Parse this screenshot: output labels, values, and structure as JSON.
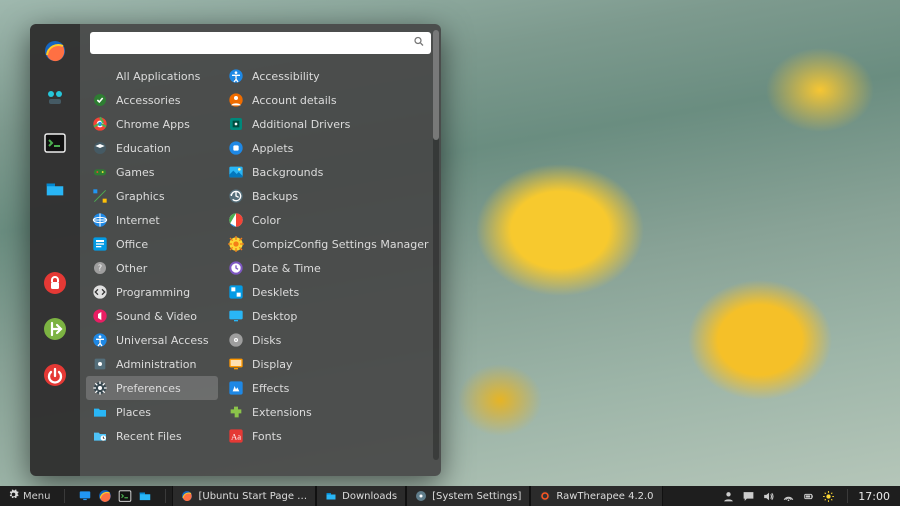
{
  "colors": {
    "panel_bg": "#1e1e1e",
    "menu_bg": "rgba(70,70,70,0.92)",
    "accent_orange": "#e64a19",
    "accent_blue": "#1e88e5",
    "accent_green": "#7cb342",
    "accent_red": "#e53935",
    "accent_yellow": "#fdd835"
  },
  "panel": {
    "menu_label": "Menu",
    "launchers": [
      {
        "name": "show-desktop-icon",
        "glyph": "desktop"
      },
      {
        "name": "firefox-icon",
        "glyph": "firefox"
      },
      {
        "name": "terminal-icon",
        "glyph": "terminal"
      },
      {
        "name": "files-icon",
        "glyph": "files"
      }
    ],
    "tasks": [
      {
        "icon": "firefox",
        "label": "[Ubuntu Start Page …"
      },
      {
        "icon": "files",
        "label": "Downloads"
      },
      {
        "icon": "settings",
        "label": "[System Settings]"
      },
      {
        "icon": "rawtherapee",
        "label": "RawTherapee 4.2.0"
      }
    ],
    "tray": [
      {
        "name": "user-icon",
        "glyph": "user"
      },
      {
        "name": "chat-icon",
        "glyph": "chat"
      },
      {
        "name": "volume-icon",
        "glyph": "volume"
      },
      {
        "name": "network-icon",
        "glyph": "network"
      },
      {
        "name": "battery-icon",
        "glyph": "battery"
      },
      {
        "name": "brightness-icon",
        "glyph": "brightness"
      }
    ],
    "clock": "17:00"
  },
  "appmenu": {
    "search_placeholder": "",
    "favorites": [
      {
        "name": "firefox-icon",
        "glyph": "firefox"
      },
      {
        "name": "hexchat-icon",
        "glyph": "hexchat"
      },
      {
        "name": "terminal-icon",
        "glyph": "terminal"
      },
      {
        "name": "files-icon",
        "glyph": "files"
      },
      {
        "name": "lock-icon",
        "glyph": "lock"
      },
      {
        "name": "logout-icon",
        "glyph": "logout"
      },
      {
        "name": "power-icon",
        "glyph": "power"
      }
    ],
    "categories": [
      {
        "label": "All Applications",
        "icon": "none",
        "all": true
      },
      {
        "label": "Accessories",
        "icon": "accessories"
      },
      {
        "label": "Chrome Apps",
        "icon": "chrome"
      },
      {
        "label": "Education",
        "icon": "education"
      },
      {
        "label": "Games",
        "icon": "games"
      },
      {
        "label": "Graphics",
        "icon": "graphics"
      },
      {
        "label": "Internet",
        "icon": "internet"
      },
      {
        "label": "Office",
        "icon": "office"
      },
      {
        "label": "Other",
        "icon": "other"
      },
      {
        "label": "Programming",
        "icon": "programming"
      },
      {
        "label": "Sound & Video",
        "icon": "sound"
      },
      {
        "label": "Universal Access",
        "icon": "access"
      },
      {
        "label": "Administration",
        "icon": "admin"
      },
      {
        "label": "Preferences",
        "icon": "prefs",
        "selected": true
      },
      {
        "label": "Places",
        "icon": "places"
      },
      {
        "label": "Recent Files",
        "icon": "recent"
      }
    ],
    "apps": [
      {
        "label": "Accessibility",
        "icon": "access-blue"
      },
      {
        "label": "Account details",
        "icon": "account"
      },
      {
        "label": "Additional Drivers",
        "icon": "drivers"
      },
      {
        "label": "Applets",
        "icon": "applets"
      },
      {
        "label": "Backgrounds",
        "icon": "backgrounds"
      },
      {
        "label": "Backups",
        "icon": "backups"
      },
      {
        "label": "Color",
        "icon": "color"
      },
      {
        "label": "CompizConfig Settings Manager",
        "icon": "ccsm"
      },
      {
        "label": "Date & Time",
        "icon": "datetime"
      },
      {
        "label": "Desklets",
        "icon": "desklets"
      },
      {
        "label": "Desktop",
        "icon": "desktop-pref"
      },
      {
        "label": "Disks",
        "icon": "disks"
      },
      {
        "label": "Display",
        "icon": "display"
      },
      {
        "label": "Effects",
        "icon": "effects"
      },
      {
        "label": "Extensions",
        "icon": "extensions"
      },
      {
        "label": "Fonts",
        "icon": "fonts"
      }
    ]
  }
}
